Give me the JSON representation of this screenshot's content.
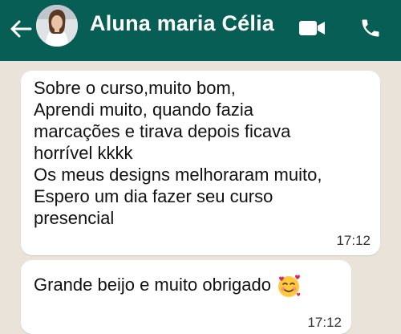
{
  "header": {
    "contact_name": "Aluna maria Célia",
    "back_icon": "arrow-left-icon",
    "video_icon": "video-camera-icon",
    "call_icon": "phone-icon",
    "header_color": "#075e54"
  },
  "messages": [
    {
      "text": "Sobre o curso,muito bom,\nAprendi muito, quando fazia\nmarcações e tirava depois ficava\nhorrível kkkk\nOs meus designs melhoraram muito,\nEspero um dia fazer seu curso\npresencial",
      "time": "17:12"
    },
    {
      "text": "Grande beijo e muito obrigado",
      "emoji": "smiling-face-with-hearts-icon",
      "time": "17:12"
    }
  ]
}
